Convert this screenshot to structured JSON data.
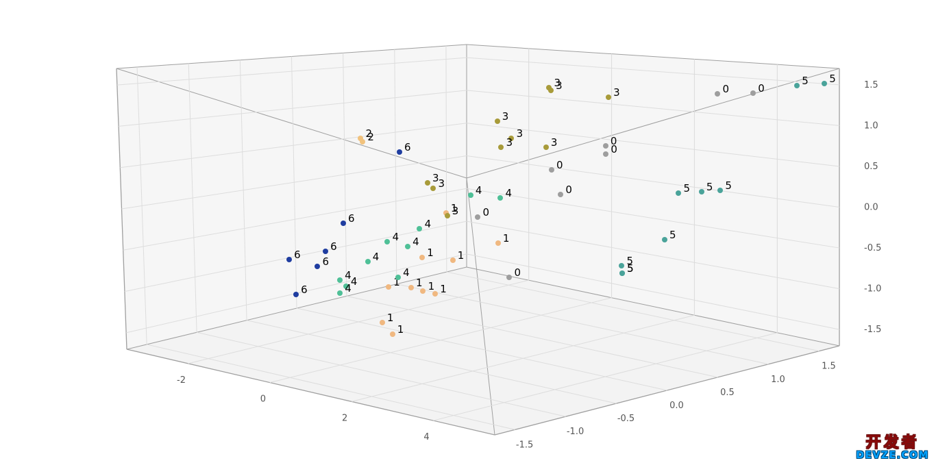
{
  "chart_data": {
    "type": "scatter",
    "projection": "3d",
    "axes": {
      "x": {
        "ticks": [
          -2,
          0,
          2,
          4
        ],
        "lim": [
          -3.5,
          5.5
        ]
      },
      "y": {
        "ticks": [
          -1.5,
          -1.0,
          -0.5,
          0.0,
          0.5,
          1.0,
          1.5
        ],
        "lim": [
          -1.7,
          1.7
        ]
      },
      "z": {
        "ticks": [
          -1.5,
          -1.0,
          -0.5,
          0.0,
          0.5,
          1.0,
          1.5
        ],
        "lim": [
          -1.7,
          1.7
        ]
      }
    },
    "cluster_colors": {
      "0": "#9e9e9e",
      "1": "#f0b880",
      "2": "#f1c27d",
      "3": "#a89b3a",
      "4": "#4fc097",
      "5": "#4aa39a",
      "6": "#1f3da0"
    },
    "points": [
      {
        "label": "0",
        "x": 3.6,
        "y": 1.3,
        "z": 1.45
      },
      {
        "label": "0",
        "x": 4.2,
        "y": 1.4,
        "z": 1.45
      },
      {
        "label": "0",
        "x": 3.2,
        "y": 0.4,
        "z": 1.05
      },
      {
        "label": "0",
        "x": 3.2,
        "y": 0.4,
        "z": 0.95
      },
      {
        "label": "0",
        "x": 2.9,
        "y": 0.0,
        "z": 0.85
      },
      {
        "label": "0",
        "x": 3.1,
        "y": 0.0,
        "z": 0.55
      },
      {
        "label": "0",
        "x": 2.6,
        "y": -0.6,
        "z": 0.4
      },
      {
        "label": "0",
        "x": 3.3,
        "y": -0.6,
        "z": -0.3
      },
      {
        "label": "1",
        "x": 1.8,
        "y": -0.6,
        "z": 0.35
      },
      {
        "label": "1",
        "x": 2.8,
        "y": -0.5,
        "z": 0.05
      },
      {
        "label": "1",
        "x": 2.2,
        "y": -1.0,
        "z": -0.05
      },
      {
        "label": "1",
        "x": 2.7,
        "y": -0.9,
        "z": -0.05
      },
      {
        "label": "1",
        "x": 2.1,
        "y": -1.3,
        "z": -0.35
      },
      {
        "label": "1",
        "x": 2.4,
        "y": -1.2,
        "z": -0.35
      },
      {
        "label": "1",
        "x": 2.7,
        "y": -1.2,
        "z": -0.35
      },
      {
        "label": "1",
        "x": 3.0,
        "y": -1.2,
        "z": -0.35
      },
      {
        "label": "1",
        "x": 2.4,
        "y": -1.5,
        "z": -0.7
      },
      {
        "label": "1",
        "x": 2.9,
        "y": -1.6,
        "z": -0.75
      },
      {
        "label": "2",
        "x": -3.1,
        "y": 0.5,
        "z": 0.55
      },
      {
        "label": "2",
        "x": -2.8,
        "y": 0.4,
        "z": 0.55
      },
      {
        "label": "3",
        "x": -0.5,
        "y": 1.3,
        "z": 1.3
      },
      {
        "label": "3",
        "x": -0.2,
        "y": 1.2,
        "z": 1.3
      },
      {
        "label": "3",
        "x": 1.2,
        "y": 1.2,
        "z": 1.3
      },
      {
        "label": "3",
        "x": -0.5,
        "y": 0.8,
        "z": 0.95
      },
      {
        "label": "3",
        "x": 0.1,
        "y": 0.7,
        "z": 0.8
      },
      {
        "label": "3",
        "x": 0.1,
        "y": 0.6,
        "z": 0.7
      },
      {
        "label": "3",
        "x": 1.2,
        "y": 0.6,
        "z": 0.8
      },
      {
        "label": "3",
        "x": -0.2,
        "y": 0.0,
        "z": 0.35
      },
      {
        "label": "3",
        "x": 0.2,
        "y": -0.1,
        "z": 0.35
      },
      {
        "label": "3",
        "x": 1.3,
        "y": -0.4,
        "z": 0.2
      },
      {
        "label": "4",
        "x": 0.6,
        "y": 0.1,
        "z": 0.25
      },
      {
        "label": "4",
        "x": 1.6,
        "y": 0.0,
        "z": 0.35
      },
      {
        "label": "4",
        "x": 0.6,
        "y": -0.4,
        "z": -0.05
      },
      {
        "label": "4",
        "x": 0.3,
        "y": -0.6,
        "z": -0.2
      },
      {
        "label": "4",
        "x": 0.8,
        "y": -0.6,
        "z": -0.2
      },
      {
        "label": "4",
        "x": 0.3,
        "y": -0.8,
        "z": -0.4
      },
      {
        "label": "4",
        "x": 1.3,
        "y": -0.9,
        "z": -0.45
      },
      {
        "label": "4",
        "x": 0.1,
        "y": -1.0,
        "z": -0.6
      },
      {
        "label": "4",
        "x": 0.5,
        "y": -1.1,
        "z": -0.6
      },
      {
        "label": "4",
        "x": 0.6,
        "y": -1.2,
        "z": -0.65
      },
      {
        "label": "5",
        "x": 5.0,
        "y": 1.5,
        "z": 1.55
      },
      {
        "label": "5",
        "x": 5.4,
        "y": 1.6,
        "z": 1.55
      },
      {
        "label": "5",
        "x": 4.7,
        "y": 0.5,
        "z": 0.55
      },
      {
        "label": "5",
        "x": 5.0,
        "y": 0.6,
        "z": 0.55
      },
      {
        "label": "5",
        "x": 5.2,
        "y": 0.7,
        "z": 0.55
      },
      {
        "label": "5",
        "x": 5.1,
        "y": 0.2,
        "z": 0.1
      },
      {
        "label": "5",
        "x": 4.8,
        "y": -0.1,
        "z": -0.15
      },
      {
        "label": "5",
        "x": 4.8,
        "y": -0.1,
        "z": -0.25
      },
      {
        "label": "5",
        "x": 4.8,
        "y": -0.1,
        "z": -0.25
      },
      {
        "label": "6",
        "x": -1.9,
        "y": 0.4,
        "z": 0.5
      },
      {
        "label": "6",
        "x": -1.3,
        "y": -0.4,
        "z": -0.2
      },
      {
        "label": "6",
        "x": -1.0,
        "y": -0.7,
        "z": -0.45
      },
      {
        "label": "6",
        "x": -1.4,
        "y": -0.9,
        "z": -0.55
      },
      {
        "label": "6",
        "x": -0.7,
        "y": -0.9,
        "z": -0.55
      },
      {
        "label": "6",
        "x": -0.5,
        "y": -1.2,
        "z": -0.8
      }
    ]
  },
  "watermark": {
    "line1": "开发者",
    "line2": "DEVZE.COM"
  },
  "axis_ticks": {
    "x": [
      "-2",
      "0",
      "2",
      "4"
    ],
    "y": [
      "-1.5",
      "-1.0",
      "-0.5",
      "0.0",
      "0.5",
      "1.0",
      "1.5"
    ],
    "z": [
      "-1.5",
      "-1.0",
      "-0.5",
      "0.0",
      "0.5",
      "1.0",
      "1.5"
    ]
  }
}
